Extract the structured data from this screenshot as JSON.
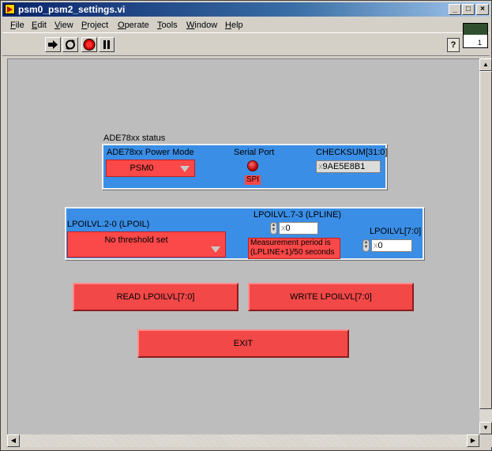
{
  "window": {
    "title": "psm0_psm2_settings.vi",
    "min_label": "_",
    "max_label": "□",
    "close_label": "×"
  },
  "menu": [
    {
      "key": "F",
      "rest": "ile"
    },
    {
      "key": "E",
      "rest": "dit"
    },
    {
      "key": "V",
      "rest": "iew"
    },
    {
      "key": "P",
      "rest": "roject"
    },
    {
      "key": "O",
      "rest": "perate"
    },
    {
      "key": "T",
      "rest": "ools"
    },
    {
      "key": "W",
      "rest": "indow"
    },
    {
      "key": "H",
      "rest": "elp"
    }
  ],
  "toolbar": {
    "run_icon": "run-arrow-icon",
    "run_continuous_icon": "run-continuously-icon",
    "abort_icon": "abort-icon",
    "pause_icon": "pause-icon",
    "help_label": "?",
    "vi_icon_text": "1"
  },
  "status_cluster": {
    "title": "ADE78xx status",
    "power_mode_label": "ADE78xx Power Mode",
    "power_mode_value": "PSM0",
    "serial_port_label": "Serial Port",
    "serial_port_led_color": "#d40000",
    "serial_port_text": "SPI",
    "checksum_label": "CHECKSUM[31:0]",
    "checksum_radix": "x",
    "checksum_value": "9AE5E8B1"
  },
  "lpoil_cluster": {
    "lpoil_label": "LPOILVL.2-0 (LPOIL)",
    "lpoil_value": "No threshold set",
    "lpline_label": "LPOILVL.7-3 (LPLINE)",
    "lpline_radix": "x",
    "lpline_value": "0",
    "measurement_note_line1": "Measurement period is",
    "measurement_note_line2": "(LPLINE+1)/50 seconds",
    "lpoilvl_label": "LPOILVL[7:0]",
    "lpoilvl_radix": "x",
    "lpoilvl_value": "0"
  },
  "buttons": {
    "read": "READ LPOILVL[7:0]",
    "write": "WRITE LPOILVL[7:0]",
    "exit": "EXIT"
  },
  "colors": {
    "cluster_blue": "#3a8ee6",
    "control_red": "#f24848",
    "panel_gray": "#bdbdbd"
  }
}
